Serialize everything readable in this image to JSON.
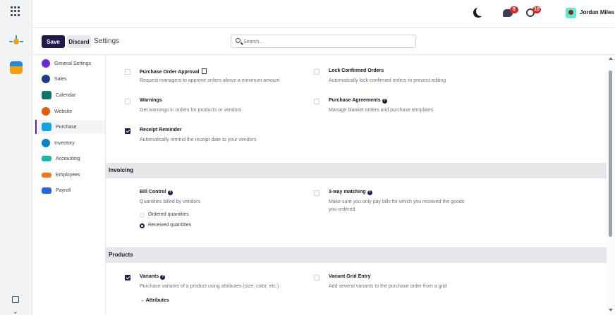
{
  "topbar": {
    "user_name": "Jordan Miles",
    "chat_badge": "8",
    "activity_badge": "10"
  },
  "control": {
    "save_label": "Save",
    "discard_label": "Discard",
    "breadcrumb": "Settings",
    "search_placeholder": "Search..."
  },
  "sidebar": {
    "items": [
      {
        "label": "General Settings",
        "color": "#6d28d9"
      },
      {
        "label": "Sales",
        "color": "#1e3a8a"
      },
      {
        "label": "Calendar",
        "color": "#0f766e"
      },
      {
        "label": "Website",
        "color": "#ea580c"
      },
      {
        "label": "Purchase",
        "color": "#0ea5e9"
      },
      {
        "label": "Inventory",
        "color": "#0284c7"
      },
      {
        "label": "Accounting",
        "color": "#14b8a6"
      },
      {
        "label": "Employees",
        "color": "#f97316"
      },
      {
        "label": "Payroll",
        "color": "#2563eb"
      }
    ],
    "active_index": 4
  },
  "orders": {
    "po_approval_title": "Purchase Order Approval",
    "po_approval_desc": "Request managers to approve orders above a minimum amount",
    "lock_title": "Lock Confirmed Orders",
    "lock_desc": "Automatically lock confirmed orders to prevent editing",
    "warnings_title": "Warnings",
    "warnings_desc": "Get warnings in orders for products or vendors",
    "agreements_title": "Purchase Agreements",
    "agreements_desc": "Manage blanket orders and purchase templates",
    "receipt_title": "Receipt Reminder",
    "receipt_desc": "Automatically remind the receipt date to your vendors"
  },
  "invoicing": {
    "header": "Invoicing",
    "bill_title": "Bill Control",
    "bill_desc": "Quantities billed by vendors",
    "radio_ordered": "Ordered quantities",
    "radio_received": "Received quantities",
    "threeway_title": "3-way matching",
    "threeway_desc1": "Make sure you only pay bills for which you received the goods",
    "threeway_desc2": "you ordered"
  },
  "products": {
    "header": "Products",
    "variants_title": "Variants",
    "variants_desc": "Purchase variants of a product using attributes (size, color, etc.)",
    "attributes_link": "→ Attributes",
    "grid_title": "Variant Grid Entry",
    "grid_desc": "Add several variants to the purchase order from a grid"
  }
}
